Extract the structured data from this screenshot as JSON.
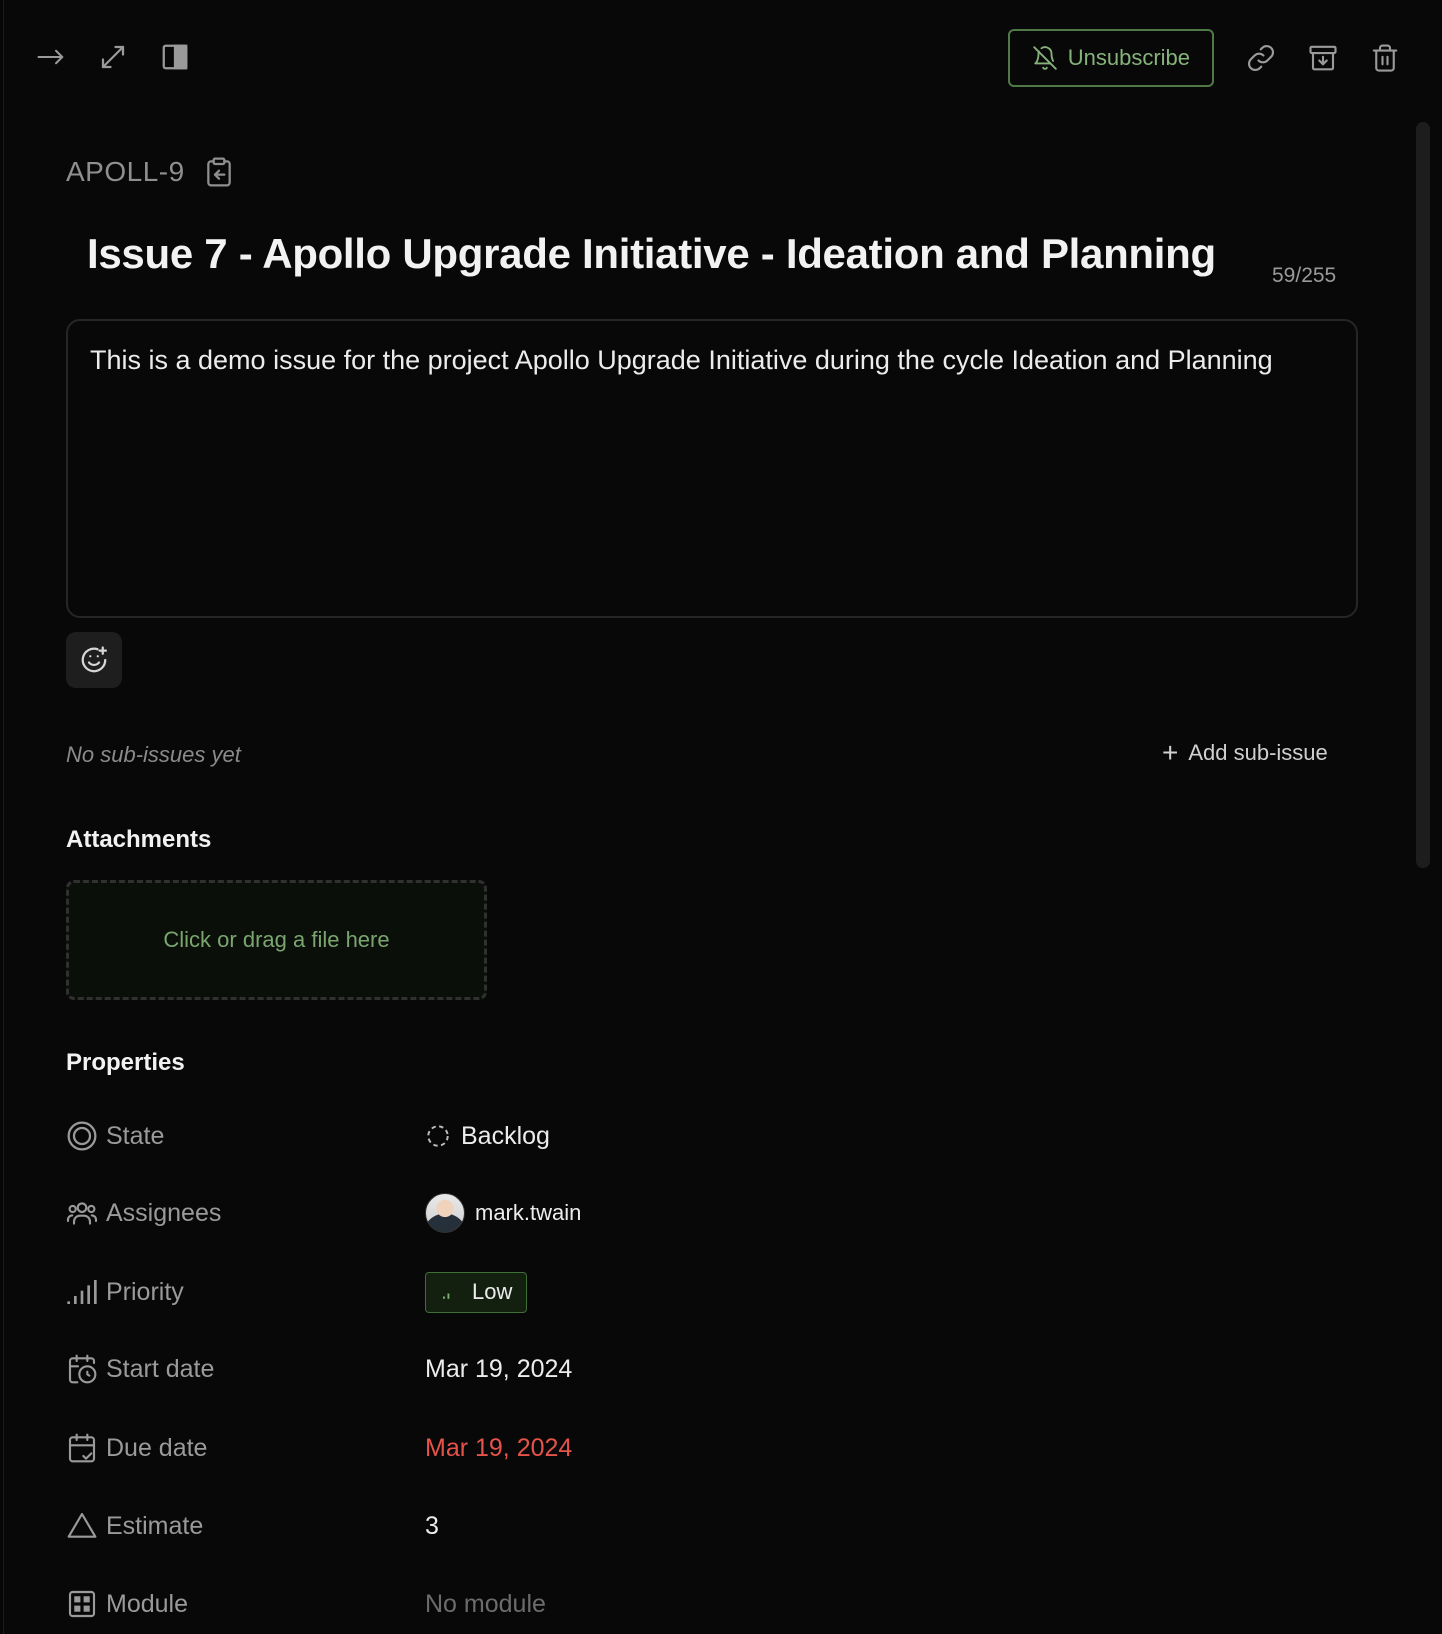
{
  "toolbar": {
    "unsubscribe_label": "Unsubscribe",
    "icons": [
      "arrow-right-icon",
      "expand-icon",
      "side-panel-icon",
      "bell-off-icon",
      "link-icon",
      "archive-icon",
      "trash-icon"
    ]
  },
  "issue": {
    "id": "APOLL-9",
    "title": "Issue 7 - Apollo Upgrade Initiative - Ideation and Planning",
    "char_count": "59/255",
    "description": "This is a demo issue for the project Apollo Upgrade Initiative during the cycle Ideation and Planning"
  },
  "sub_issues": {
    "empty_text": "No sub-issues yet",
    "add_label": "Add sub-issue"
  },
  "attachments": {
    "heading": "Attachments",
    "dropzone_text": "Click or drag a file here"
  },
  "properties": {
    "heading": "Properties",
    "state": {
      "label": "State",
      "value": "Backlog"
    },
    "assignees": {
      "label": "Assignees",
      "value": "mark.twain"
    },
    "priority": {
      "label": "Priority",
      "value": "Low"
    },
    "start_date": {
      "label": "Start date",
      "value": "Mar 19, 2024"
    },
    "due_date": {
      "label": "Due date",
      "value": "Mar 19, 2024"
    },
    "estimate": {
      "label": "Estimate",
      "value": "3"
    },
    "module": {
      "label": "Module",
      "value": "No module"
    }
  },
  "colors": {
    "accent_green": "#86b37a",
    "due_red": "#e5534b",
    "background": "#080808"
  }
}
